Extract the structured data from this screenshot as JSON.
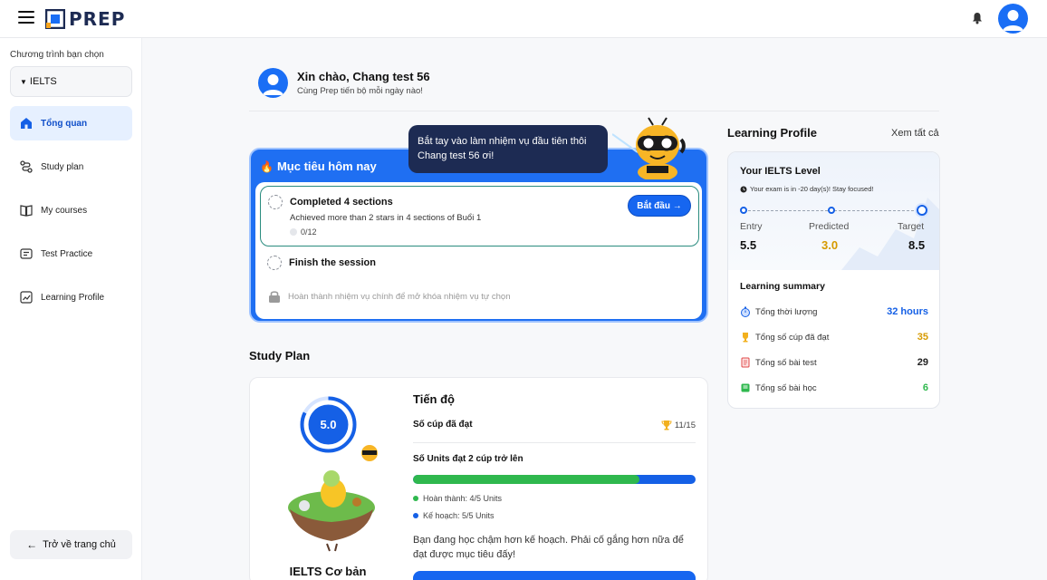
{
  "header": {
    "logo_text": "PREP",
    "icons": [
      "hamburger-icon",
      "bell-icon",
      "user-avatar"
    ]
  },
  "sidebar": {
    "program_label": "Chương trình bạn chọn",
    "program_value": "IELTS",
    "items": [
      {
        "label": "Tổng quan",
        "icon": "home-icon",
        "active": true
      },
      {
        "label": "Study plan",
        "icon": "route-icon",
        "active": false
      },
      {
        "label": "My courses",
        "icon": "book-icon",
        "active": false
      },
      {
        "label": "Test Practice",
        "icon": "test-icon",
        "active": false
      },
      {
        "label": "Learning Profile",
        "icon": "profile-chart-icon",
        "active": false
      }
    ],
    "back_label": "Trở về trang chủ"
  },
  "greeting": {
    "title": "Xin chào, Chang test 56",
    "subtitle": "Cùng Prep tiến bộ mỗi ngày nào!"
  },
  "goals": {
    "title": "Mục tiêu hôm nay",
    "speech": "Bắt tay vào làm nhiệm vụ đầu tiên thôi Chang test 56 ơi!",
    "task1": {
      "title": "Completed 4 sections",
      "subtitle": "Achieved more than 2 stars in 4 sections of Buổi 1",
      "progress": "0/12",
      "button": "Bắt đầu →"
    },
    "task2": {
      "title": "Finish the session"
    },
    "task3": {
      "text": "Hoàn thành nhiệm vụ chính để mở khóa nhiệm vụ tự chọn"
    }
  },
  "study_plan": {
    "heading": "Study Plan",
    "score": "5.0",
    "course_name": "IELTS Cơ bản",
    "progress_title": "Tiến độ",
    "cups_label": "Số cúp đã đạt",
    "cups_value": "11/15",
    "units_title": "Số Units đạt 2 cúp trở lên",
    "completed_fraction": 0.8,
    "legend_completed": "Hoàn thành: 4/5 Units",
    "legend_planned": "Kế hoạch: 5/5 Units",
    "message": "Bạn đang học chậm hơn kế hoạch. Phải cố gắng hơn nữa để đạt được mục tiêu đấy!",
    "colors": {
      "completed": "#2fb84e",
      "planned": "#1560e6"
    }
  },
  "profile": {
    "title": "Learning Profile",
    "see_all": "Xem tất cả",
    "level_title": "Your IELTS Level",
    "exam_note": "Your exam is in -20 day(s)! Stay focused!",
    "entry_label": "Entry",
    "entry_value": "5.5",
    "predicted_label": "Predicted",
    "predicted_value": "3.0",
    "target_label": "Target",
    "target_value": "8.5",
    "summary_title": "Learning summary",
    "summary": [
      {
        "label": "Tổng thời lượng",
        "value": "32 hours",
        "icon": "stopwatch-icon",
        "color": "#1560e6"
      },
      {
        "label": "Tổng số cúp đã đạt",
        "value": "35",
        "icon": "trophy-icon",
        "color": "#d69a00"
      },
      {
        "label": "Tổng số bài test",
        "value": "29",
        "icon": "test-paper-icon",
        "color": "#222222"
      },
      {
        "label": "Tổng số bài học",
        "value": "6",
        "icon": "lesson-book-icon",
        "color": "#2fb84e"
      }
    ],
    "colors": {
      "predicted": "#d69a00"
    }
  }
}
